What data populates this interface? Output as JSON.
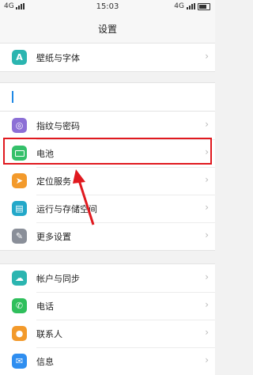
{
  "status_bar": {
    "network_left": "4G",
    "time": "15:03",
    "network_right": "4G"
  },
  "header": {
    "title": "设置"
  },
  "groups": [
    {
      "items": [
        {
          "label": "壁纸与字体",
          "icon": "wallpaper-font-icon",
          "icon_color": "#2bb5b0",
          "icon_glyph": "A"
        }
      ]
    },
    {
      "items": [
        {
          "label": "",
          "icon": "text-cursor-icon"
        }
      ]
    },
    {
      "items": [
        {
          "label": "指纹与密码",
          "icon": "fingerprint-icon",
          "icon_color": "#8c6fd6",
          "icon_glyph": "◎"
        },
        {
          "label": "电池",
          "icon": "battery-icon",
          "icon_color": "#34c06a",
          "icon_glyph": "▬"
        },
        {
          "label": "定位服务",
          "icon": "location-icon",
          "icon_color": "#f39a2b",
          "icon_glyph": "➤"
        },
        {
          "label": "运行与存储空间",
          "icon": "storage-icon",
          "icon_color": "#23a8c9",
          "icon_glyph": "▤"
        },
        {
          "label": "更多设置",
          "icon": "more-settings-icon",
          "icon_color": "#8a8f99",
          "icon_glyph": "✎"
        }
      ]
    },
    {
      "items": [
        {
          "label": "帐户与同步",
          "icon": "account-sync-icon",
          "icon_color": "#2bb5b0",
          "icon_glyph": "☁"
        },
        {
          "label": "电话",
          "icon": "phone-icon",
          "icon_color": "#2fbf5c",
          "icon_glyph": "✆"
        },
        {
          "label": "联系人",
          "icon": "contacts-icon",
          "icon_color": "#f39a2b",
          "icon_glyph": "👤"
        },
        {
          "label": "信息",
          "icon": "messages-icon",
          "icon_color": "#2f8ef0",
          "icon_glyph": "✉"
        }
      ]
    }
  ],
  "highlight_color": "#e0191f"
}
